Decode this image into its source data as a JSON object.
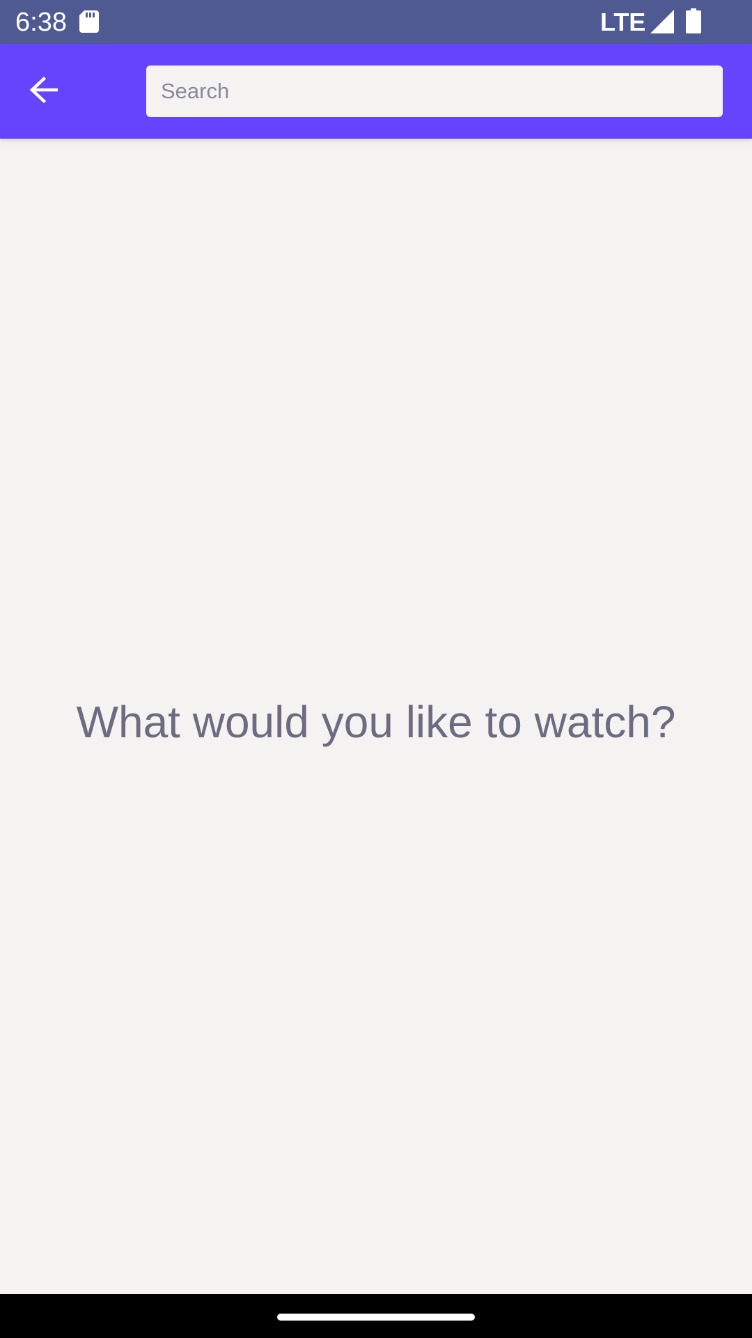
{
  "status_bar": {
    "time": "6:38",
    "network": "LTE",
    "icons": [
      "sd-card-icon",
      "signal-icon",
      "battery-icon"
    ],
    "background": "#4F5A93"
  },
  "app_bar": {
    "background": "#6444FC",
    "back_icon": "arrow-back-icon",
    "search": {
      "placeholder": "Search",
      "value": ""
    }
  },
  "main": {
    "prompt": "What would you like to watch?"
  },
  "nav_bar": {
    "background": "#000000"
  }
}
